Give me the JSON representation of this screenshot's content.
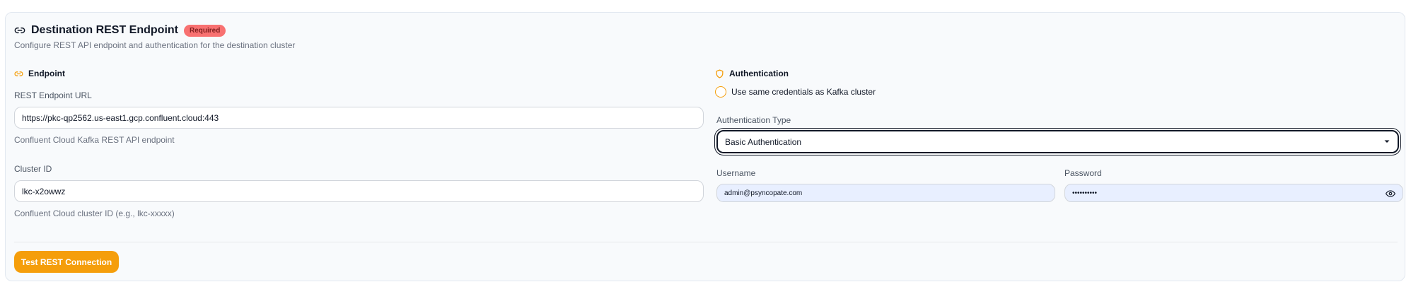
{
  "header": {
    "title": "Destination REST Endpoint",
    "badge": "Required",
    "subtitle": "Configure REST API endpoint and authentication for the destination cluster"
  },
  "endpoint": {
    "section_title": "Endpoint",
    "url_label": "REST Endpoint URL",
    "url_value": "https://pkc-qp2562.us-east1.gcp.confluent.cloud:443",
    "url_help": "Confluent Cloud Kafka REST API endpoint",
    "cluster_label": "Cluster ID",
    "cluster_value": "lkc-x2owwz",
    "cluster_help": "Confluent Cloud cluster ID (e.g., lkc-xxxxx)"
  },
  "auth": {
    "section_title": "Authentication",
    "same_credentials_label": "Use same credentials as Kafka cluster",
    "type_label": "Authentication Type",
    "type_value": "Basic Authentication",
    "username_label": "Username",
    "username_value": "admin@psyncopate.com",
    "password_label": "Password",
    "password_value": "••••••••••"
  },
  "actions": {
    "test_button": "Test REST Connection"
  },
  "colors": {
    "accent": "#f59e0b",
    "badge_bg": "#f87171",
    "filled_input_bg": "#e8efff"
  },
  "icons": {
    "header": "link-icon",
    "endpoint": "link-icon",
    "auth": "shield-icon",
    "select": "chevron-down-icon",
    "password": "eye-icon"
  }
}
